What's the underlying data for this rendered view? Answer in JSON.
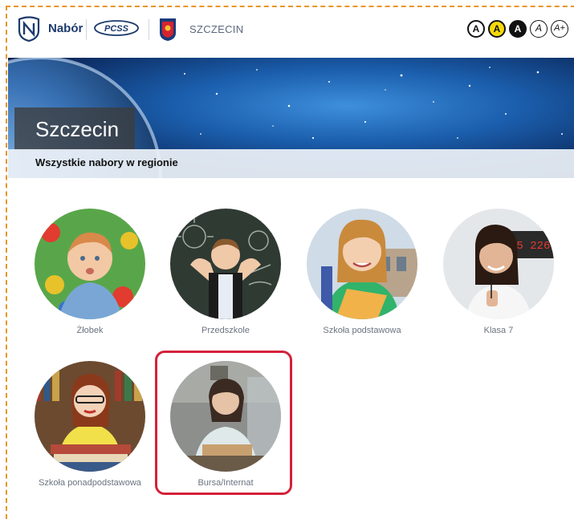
{
  "header": {
    "brand": "Nabór",
    "pcss_logo_text": "PCSS",
    "city": "SZCZECIN",
    "accessibility_buttons": [
      {
        "label": "A",
        "name": "contrast-default-button"
      },
      {
        "label": "A",
        "name": "contrast-yellow-button"
      },
      {
        "label": "A",
        "name": "contrast-black-button"
      },
      {
        "label": "A",
        "name": "font-small-button"
      },
      {
        "label": "A+",
        "name": "font-large-button"
      }
    ]
  },
  "banner": {
    "title": "Szczecin",
    "subtitle": "Wszystkie nabory w regionie"
  },
  "tiles": [
    {
      "label": "Żłobek"
    },
    {
      "label": "Przedszkole"
    },
    {
      "label": "Szkoła podstawowa"
    },
    {
      "label": "Klasa 7"
    },
    {
      "label": "Szkoła ponadpodstawowa"
    },
    {
      "label": "Bursa/Internat"
    }
  ],
  "colors": {
    "brand_navy": "#1d3a6e",
    "highlight_red": "#d4213a",
    "dashed_border": "#e8952a"
  }
}
